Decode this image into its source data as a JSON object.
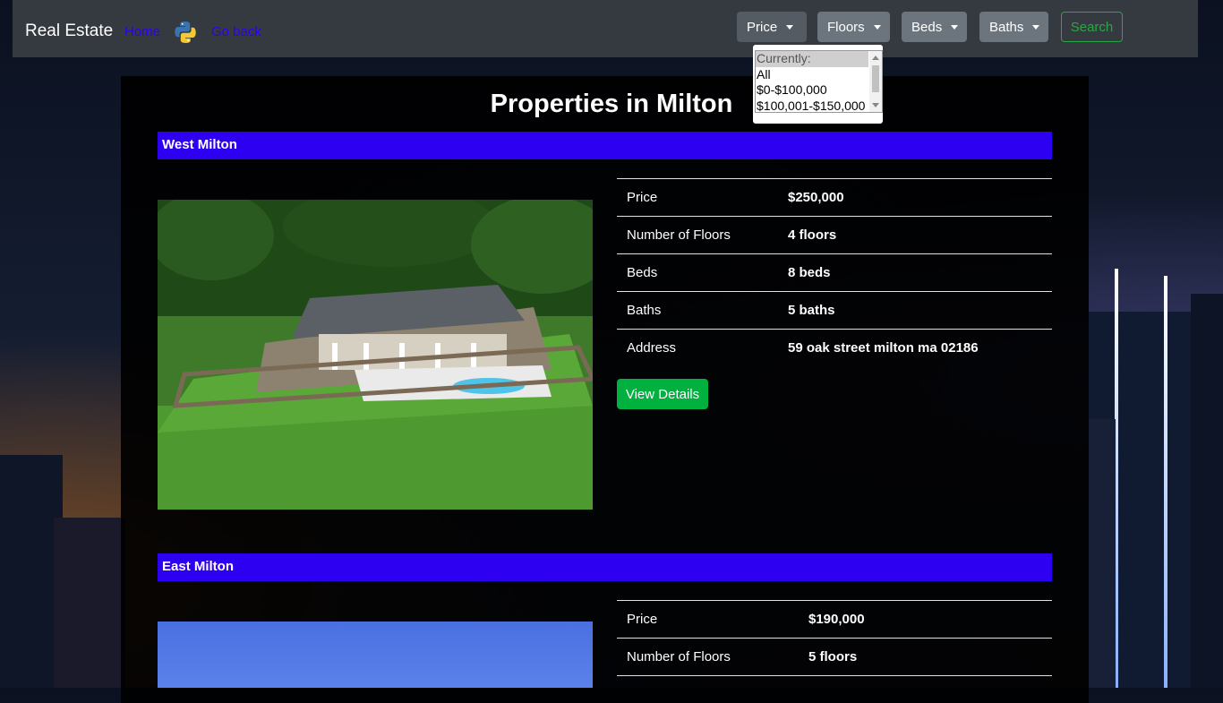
{
  "navbar": {
    "brand": "Real Estate",
    "links": [
      {
        "label": "Home"
      },
      {
        "label": "Go back"
      }
    ],
    "logo_icon": "python-logo-icon",
    "filters": [
      {
        "label": "Price"
      },
      {
        "label": "Floors"
      },
      {
        "label": "Beds"
      },
      {
        "label": "Baths"
      }
    ],
    "search_label": "Search"
  },
  "price_dropdown": {
    "options": [
      "Currently:",
      "All",
      "$0-$100,000",
      "$100,001-$150,000"
    ],
    "selected": "Currently:"
  },
  "page": {
    "title": "Properties in Milton"
  },
  "properties": [
    {
      "name": "West Milton",
      "details": [
        {
          "label": "Price",
          "value": "$250,000"
        },
        {
          "label": "Number of Floors",
          "value": "4 floors"
        },
        {
          "label": "Beds",
          "value": "8 beds"
        },
        {
          "label": "Baths",
          "value": "5 baths"
        },
        {
          "label": "Address",
          "value": "59 oak street milton ma 02186"
        }
      ],
      "button_label": "View Details"
    },
    {
      "name": "East Milton",
      "details": [
        {
          "label": "Price",
          "value": "$190,000"
        },
        {
          "label": "Number of Floors",
          "value": "5 floors"
        }
      ]
    }
  ],
  "colors": {
    "navbar": "#343a40",
    "section_bar": "#2d00f2",
    "link": "#2d00f2",
    "view_button": "#00b140",
    "search_outline": "#28a745"
  }
}
